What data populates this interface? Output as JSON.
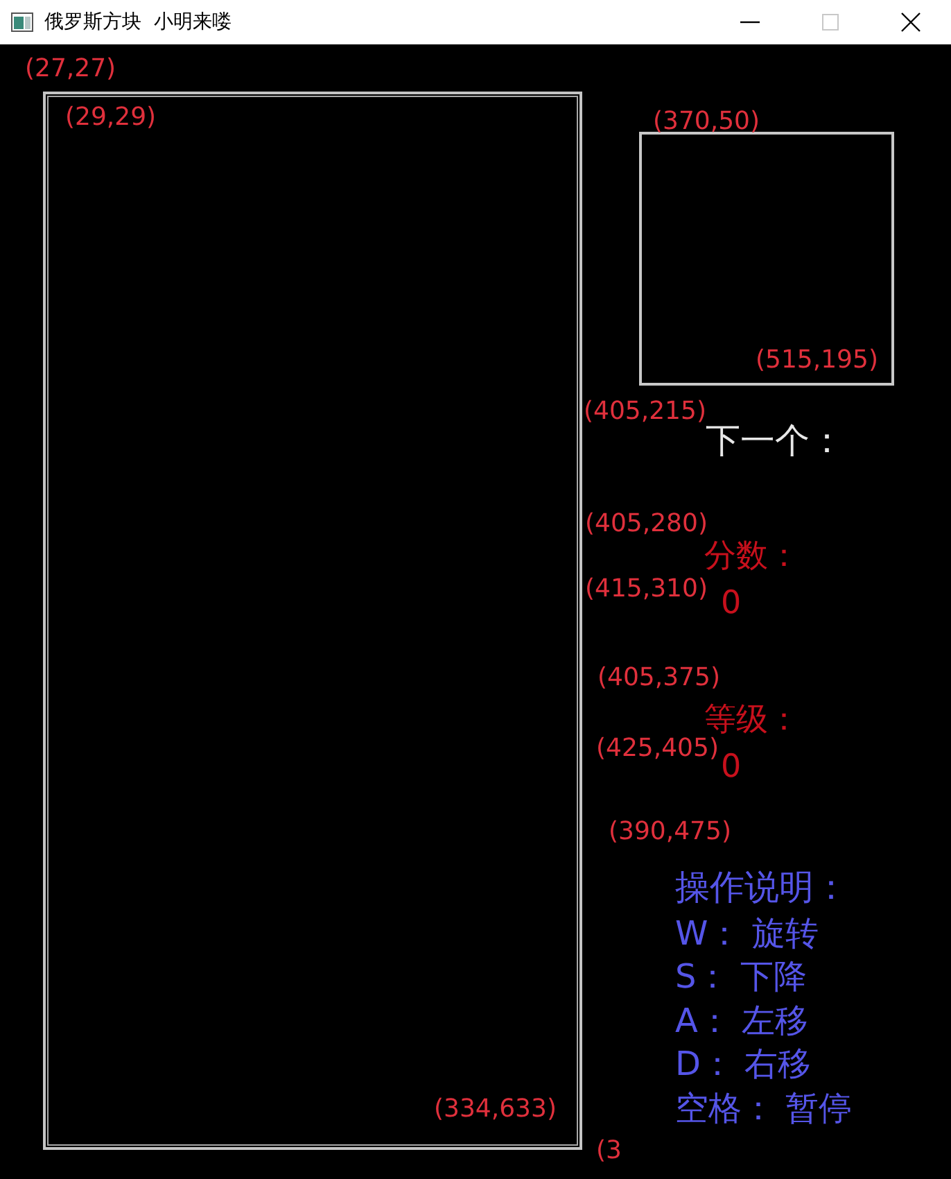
{
  "window": {
    "title": "俄罗斯方块  小明来喽",
    "maximize": {
      "disabled": true
    }
  },
  "annotations": [
    "(27,27)",
    "(29,29)",
    "(370,50)",
    "(515,195)",
    "(405,215)",
    "(405,280)",
    "(415,310)",
    "(405,375)",
    "(425,405)",
    "(390,475)",
    "(334,633)",
    "(3"
  ],
  "side_panel": {
    "next_label": "下一个：",
    "score": {
      "label": "分数：",
      "value": "0"
    },
    "level": {
      "label": "等级：",
      "value": "0"
    },
    "help": {
      "title": "操作说明：",
      "lines": [
        "W： 旋转",
        "S： 下降",
        "A： 左移",
        "D： 右移",
        "空格： 暂停"
      ]
    }
  }
}
